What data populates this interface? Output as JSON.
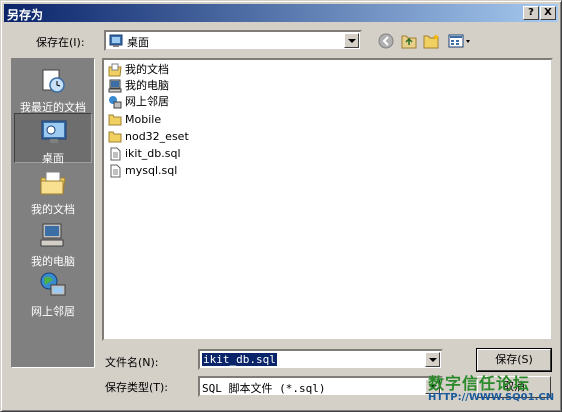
{
  "window": {
    "title": "另存为",
    "help_btn": "?",
    "close_btn": "X"
  },
  "toolbar": {
    "save_in_label": "保存在(I):",
    "save_in_value": "桌面"
  },
  "places": [
    {
      "label": "我最近的文档",
      "icon": "recent-docs-icon"
    },
    {
      "label": "桌面",
      "icon": "desktop-icon",
      "selected": true
    },
    {
      "label": "我的文档",
      "icon": "my-documents-icon"
    },
    {
      "label": "我的电脑",
      "icon": "my-computer-icon"
    },
    {
      "label": "网上邻居",
      "icon": "network-places-icon"
    }
  ],
  "files": [
    {
      "name": "我的文档",
      "icon": "my-documents-icon"
    },
    {
      "name": "我的电脑",
      "icon": "my-computer-icon"
    },
    {
      "name": "网上邻居",
      "icon": "network-places-icon"
    },
    {
      "name": "Mobile",
      "icon": "folder-icon"
    },
    {
      "name": "nod32_eset",
      "icon": "folder-icon"
    },
    {
      "name": "ikit_db.sql",
      "icon": "file-icon"
    },
    {
      "name": "mysql.sql",
      "icon": "file-icon"
    }
  ],
  "form": {
    "filename_label": "文件名(N):",
    "filename_value": "ikit_db.sql",
    "filetype_label": "保存类型(T):",
    "filetype_value": "SQL 脚本文件 (*.sql)",
    "save_button": "保存(S)",
    "cancel_button": "取消"
  },
  "watermark": {
    "line1": "数字信任论坛",
    "line2": "HTTP://WWW.SQ01.CN"
  }
}
